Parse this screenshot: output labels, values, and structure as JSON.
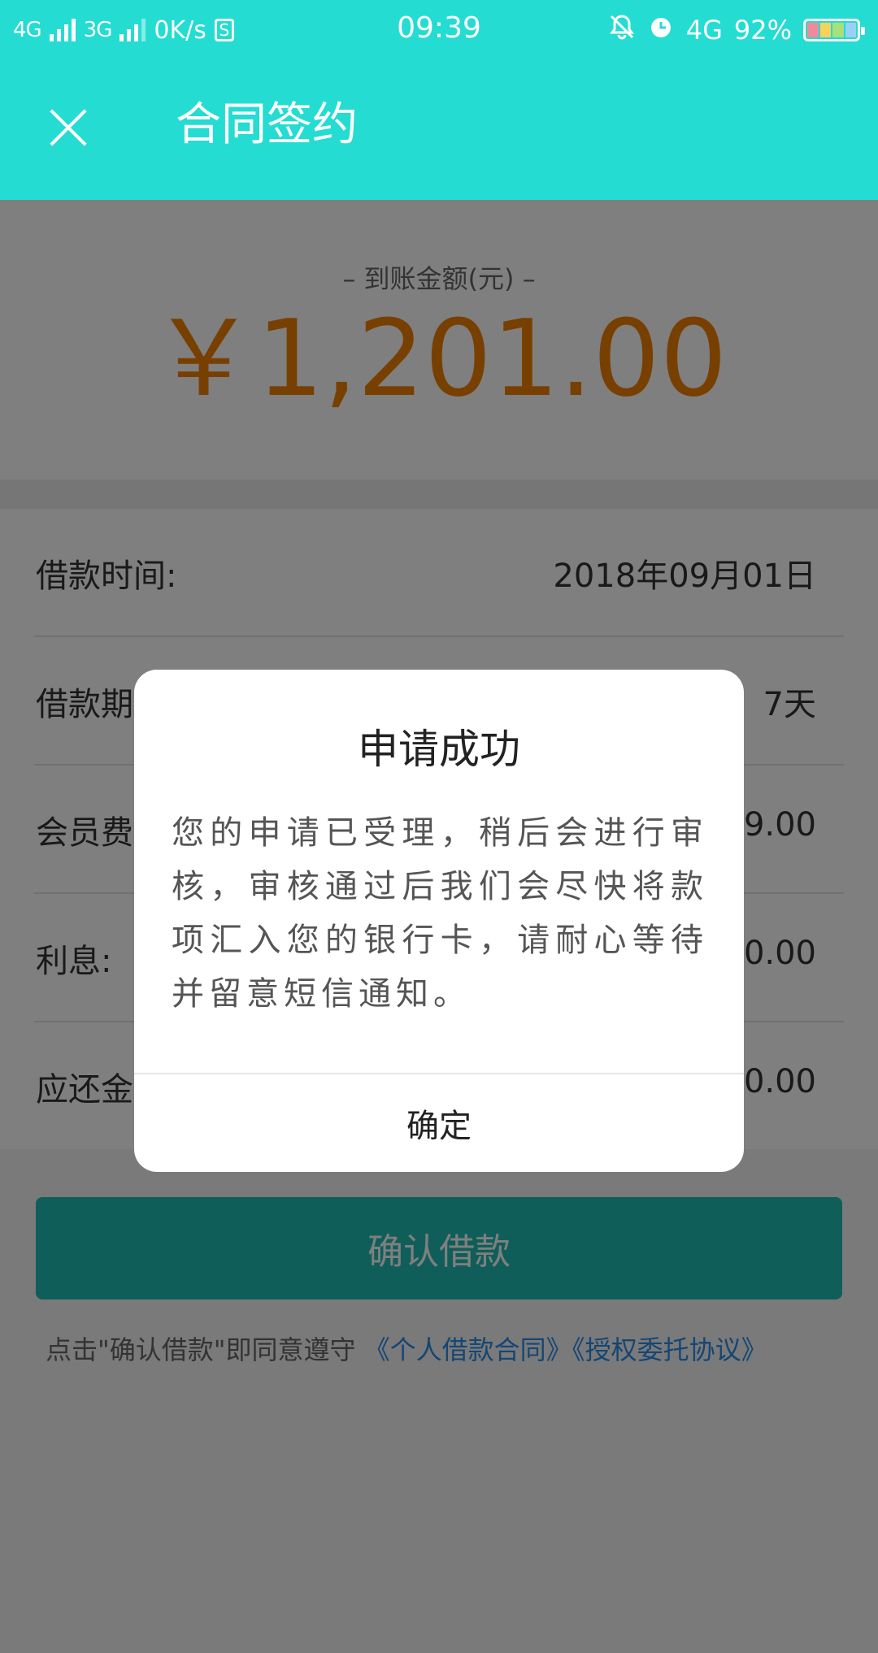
{
  "status_bar": {
    "network1": "4G",
    "network2": "3G",
    "speed": "0K/s",
    "s_icon": "S",
    "time": "09:39",
    "network3": "4G",
    "battery": "92%"
  },
  "header": {
    "title": "合同签约",
    "close_icon": "close-icon"
  },
  "amount": {
    "label": "– 到账金额(元) –",
    "value": "￥1,201.00"
  },
  "details": [
    {
      "label": "借款时间:",
      "value": "2018年09月01日"
    },
    {
      "label": "借款期",
      "value": "7天"
    },
    {
      "label": "会员费",
      "value": "9.00"
    },
    {
      "label": "利息:",
      "value": "0.00"
    },
    {
      "label": "应还金",
      "value": "0.00"
    }
  ],
  "confirm_button": "确认借款",
  "agreement": {
    "prefix": "点击\"确认借款\"即同意遵守",
    "link1": "《个人借款合同》",
    "link2": "《授权委托协议》"
  },
  "dialog": {
    "title": "申请成功",
    "message": "您的申请已受理，稍后会进行审核，审核通过后我们会尽快将款项汇入您的银行卡，请耐心等待并留意短信通知。",
    "ok_button": "确定"
  },
  "colors": {
    "brand": "#24dcd2",
    "amount": "#f08000",
    "link": "#2a8de6"
  }
}
